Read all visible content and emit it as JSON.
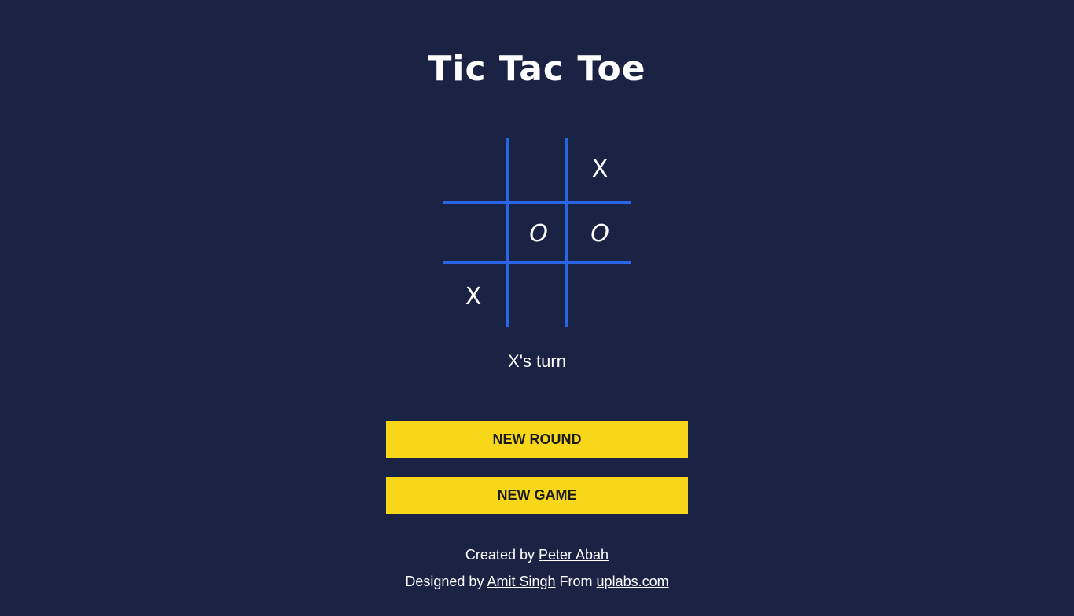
{
  "title": "Tic Tac Toe",
  "board": {
    "cells": [
      "",
      "",
      "X",
      "",
      "O",
      "O",
      "X",
      "",
      ""
    ]
  },
  "status": "X's turn",
  "buttons": {
    "new_round": "NEW ROUND",
    "new_game": "NEW GAME"
  },
  "footer": {
    "created_prefix": "Created by",
    "creator": "Peter Abah",
    "designed_prefix": "Designed by",
    "designer": "Amit Singh",
    "from_text": "From",
    "source": "uplabs.com"
  },
  "colors": {
    "background": "#1b2345",
    "grid": "#2a65e8",
    "button": "#f8d71a"
  }
}
